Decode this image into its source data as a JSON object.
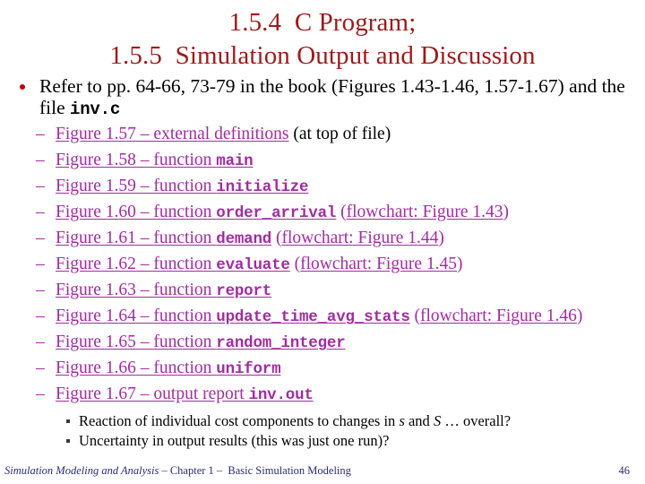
{
  "title": {
    "line1": "1.5.4  C Program;",
    "line2": "1.5.5  Simulation Output and Discussion",
    "color": "#9e1a1a"
  },
  "intro": {
    "bullet_marker": "red-dot-bullet",
    "text_part1": "Refer to pp. 64-66, 73-79 in the book (Figures 1.43-1.46, 1.57-1.67) and the file ",
    "code": "inv.c"
  },
  "link_color": "#a32ba3",
  "figures": [
    {
      "dash": "–",
      "link_prefix": "Figure 1.57 – external definitions",
      "code": "",
      "suffix_plain": " (at top of file)",
      "suffix_link": ""
    },
    {
      "dash": "–",
      "link_prefix": "Figure 1.58 – function ",
      "code": "main",
      "suffix_plain": "",
      "suffix_link": ""
    },
    {
      "dash": "–",
      "link_prefix": "Figure 1.59 – function ",
      "code": "initialize",
      "suffix_plain": "",
      "suffix_link": ""
    },
    {
      "dash": "–",
      "link_prefix": "Figure 1.60 – function ",
      "code": "order_arrival",
      "suffix_plain": "",
      "suffix_link": "flowchart: Figure 1.43"
    },
    {
      "dash": "–",
      "link_prefix": "Figure 1.61 – function ",
      "code": "demand",
      "suffix_plain": "",
      "suffix_link": "flowchart: Figure 1.44"
    },
    {
      "dash": "–",
      "link_prefix": "Figure 1.62 – function ",
      "code": "evaluate",
      "suffix_plain": "",
      "suffix_link": "flowchart: Figure 1.45"
    },
    {
      "dash": "–",
      "link_prefix": "Figure 1.63 – function ",
      "code": "report",
      "suffix_plain": "",
      "suffix_link": ""
    },
    {
      "dash": "–",
      "link_prefix": "Figure 1.64 – function ",
      "code": "update_time_avg_stats",
      "suffix_plain": "",
      "suffix_link": "flowchart: Figure 1.46"
    },
    {
      "dash": "–",
      "link_prefix": "Figure 1.65 – function ",
      "code": "random_integer",
      "suffix_plain": "",
      "suffix_link": ""
    },
    {
      "dash": "–",
      "link_prefix": "Figure 1.66 – function ",
      "code": "uniform",
      "suffix_plain": "",
      "suffix_link": ""
    },
    {
      "dash": "–",
      "link_prefix": "Figure 1.67 – output report ",
      "code": "inv.out",
      "suffix_plain": "",
      "suffix_link": ""
    }
  ],
  "discussion": [
    {
      "marker": "square-bullet",
      "pre": "Reaction of individual cost components to changes in ",
      "var1": "s",
      "mid": " and ",
      "var2": "S",
      "post": " … overall?"
    },
    {
      "marker": "square-bullet",
      "pre": "Uncertainty in output results (this was just one run)?",
      "var1": "",
      "mid": "",
      "var2": "",
      "post": ""
    }
  ],
  "footer": {
    "book_title": "Simulation Modeling and Analysis",
    "rest": " – Chapter 1 –  Basic Simulation Modeling",
    "page_number": "46",
    "color": "#2b2b7f"
  }
}
